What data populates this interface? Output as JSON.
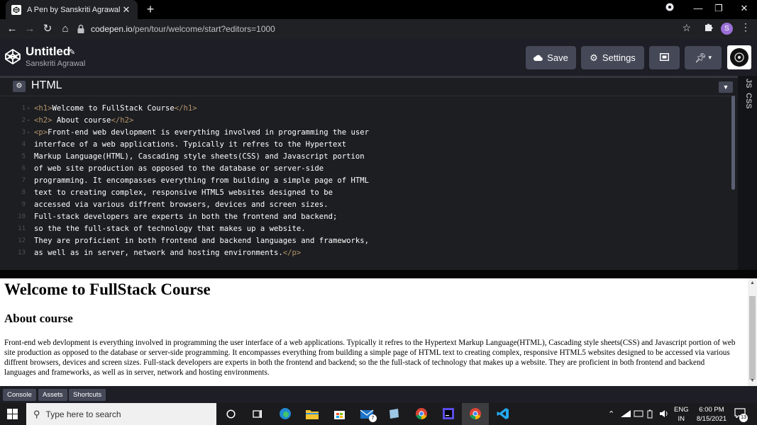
{
  "browser": {
    "tab_title": "A Pen by Sanskriti Agrawal",
    "new_tab_symbol": "+",
    "close_symbol": "✕",
    "url_host": "codepen.io",
    "url_path": "/pen/tour/welcome/start?editors=1000",
    "profile_initial": "S"
  },
  "codepen": {
    "title": "Untitled",
    "author": "Sanskriti Agrawal",
    "save_label": "Save",
    "settings_label": "Settings"
  },
  "editor": {
    "name": "HTML",
    "side_tabs": [
      "JS",
      "CSS"
    ],
    "lines": [
      {
        "num": "1",
        "parts": [
          {
            "t": "tag",
            "v": "<h1>"
          },
          {
            "t": "txt",
            "v": "Welcome to FullStack Course"
          },
          {
            "t": "tag",
            "v": "</h1>"
          }
        ]
      },
      {
        "num": "2",
        "parts": [
          {
            "t": "tag",
            "v": "<h2>"
          },
          {
            "t": "txt",
            "v": " About course"
          },
          {
            "t": "tag",
            "v": "</h2>"
          }
        ]
      },
      {
        "num": "3",
        "parts": [
          {
            "t": "tag",
            "v": "<p>"
          },
          {
            "t": "txt",
            "v": "Front-end web devlopment is everything involved in programming the user"
          }
        ]
      },
      {
        "num": "4",
        "parts": [
          {
            "t": "txt",
            "v": "interface of a web applications. Typically it refres to the Hypertext"
          }
        ]
      },
      {
        "num": "5",
        "parts": [
          {
            "t": "txt",
            "v": "Markup Language(HTML), Cascading style sheets(CSS) and Javascript portion"
          }
        ]
      },
      {
        "num": "6",
        "parts": [
          {
            "t": "txt",
            "v": "of web site production as opposed to the database or server-side"
          }
        ]
      },
      {
        "num": "7",
        "parts": [
          {
            "t": "txt",
            "v": "programming. It encompasses everything from building a simple page of HTML"
          }
        ]
      },
      {
        "num": "8",
        "parts": [
          {
            "t": "txt",
            "v": "text to creating complex, responsive HTML5 websites designed to be"
          }
        ]
      },
      {
        "num": "9",
        "parts": [
          {
            "t": "txt",
            "v": "accessed via various diffrent browsers, devices and screen sizes."
          }
        ]
      },
      {
        "num": "10",
        "parts": [
          {
            "t": "txt",
            "v": "Full-stack developers are experts in both the frontend and backend;"
          }
        ]
      },
      {
        "num": "11",
        "parts": [
          {
            "t": "txt",
            "v": "so the the full-stack of technology that makes up a website."
          }
        ]
      },
      {
        "num": "12",
        "parts": [
          {
            "t": "txt",
            "v": "They are proficient in both frontend and backend languages and frameworks,"
          }
        ]
      },
      {
        "num": "13",
        "parts": [
          {
            "t": "txt",
            "v": "as well as in server, network and hosting environments."
          },
          {
            "t": "tag",
            "v": "</p>"
          }
        ]
      }
    ]
  },
  "preview": {
    "h1": "Welcome to FullStack Course",
    "h2": "About course",
    "p": "Front-end web devlopment is everything involved in programming the user interface of a web applications. Typically it refres to the Hypertext Markup Language(HTML), Cascading style sheets(CSS) and Javascript portion of web site production as opposed to the database or server-side programming. It encompasses everything from building a simple page of HTML text to creating complex, responsive HTML5 websites designed to be accessed via various diffrent browsers, devices and screen sizes. Full-stack developers are experts in both the frontend and backend; so the the full-stack of technology that makes up a website. They are proficient in both frontend and backend languages and frameworks, as well as in server, network and hosting environments."
  },
  "footer": {
    "buttons": [
      "Console",
      "Assets",
      "Shortcuts"
    ]
  },
  "taskbar": {
    "search_placeholder": "Type here to search",
    "mail_badge": "7",
    "lang_line1": "ENG",
    "lang_line2": "IN",
    "time": "6:00 PM",
    "date": "8/15/2021",
    "notification_count": "13"
  },
  "colors": {
    "tag": "#b4946a",
    "editor_bg": "#1d1e22",
    "button_bg": "#444857",
    "header_bg": "#1e1f26"
  }
}
